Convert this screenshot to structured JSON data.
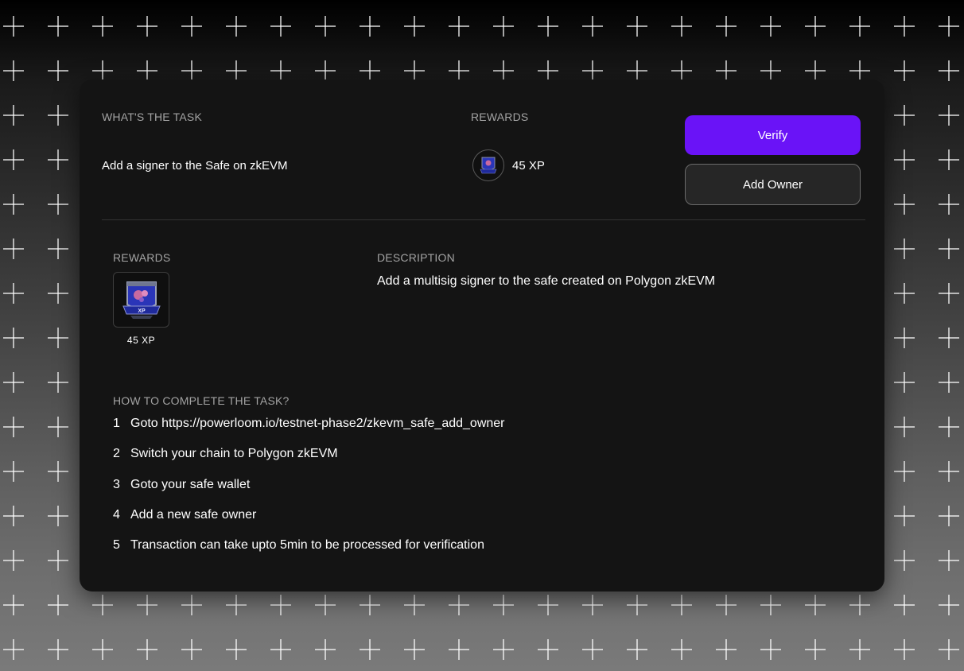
{
  "task": {
    "section_label": "WHAT'S THE TASK",
    "title": "Add a signer to the Safe on zkEVM"
  },
  "rewards_top": {
    "label": "REWARDS",
    "xp": "45 XP"
  },
  "buttons": {
    "verify": "Verify",
    "add_owner": "Add Owner"
  },
  "rewards_detail": {
    "label": "REWARDS",
    "xp": "45 XP"
  },
  "description": {
    "label": "DESCRIPTION",
    "text": "Add a multisig signer to the safe created on Polygon zkEVM"
  },
  "how_to": {
    "label": "HOW TO COMPLETE THE TASK?",
    "steps": [
      {
        "num": "1",
        "text": "Goto https://powerloom.io/testnet-phase2/zkevm_safe_add_owner"
      },
      {
        "num": "2",
        "text": "Switch your chain to Polygon zkEVM"
      },
      {
        "num": "3",
        "text": "Goto your safe wallet"
      },
      {
        "num": "4",
        "text": "Add a new safe owner"
      },
      {
        "num": "5",
        "text": "Transaction can take upto 5min to be processed for verification"
      }
    ]
  },
  "colors": {
    "accent": "#6a13f7",
    "card_bg": "#141414",
    "muted_label": "#a3a3a3"
  },
  "icons": {
    "reward_badge": "xp-badge-icon"
  }
}
